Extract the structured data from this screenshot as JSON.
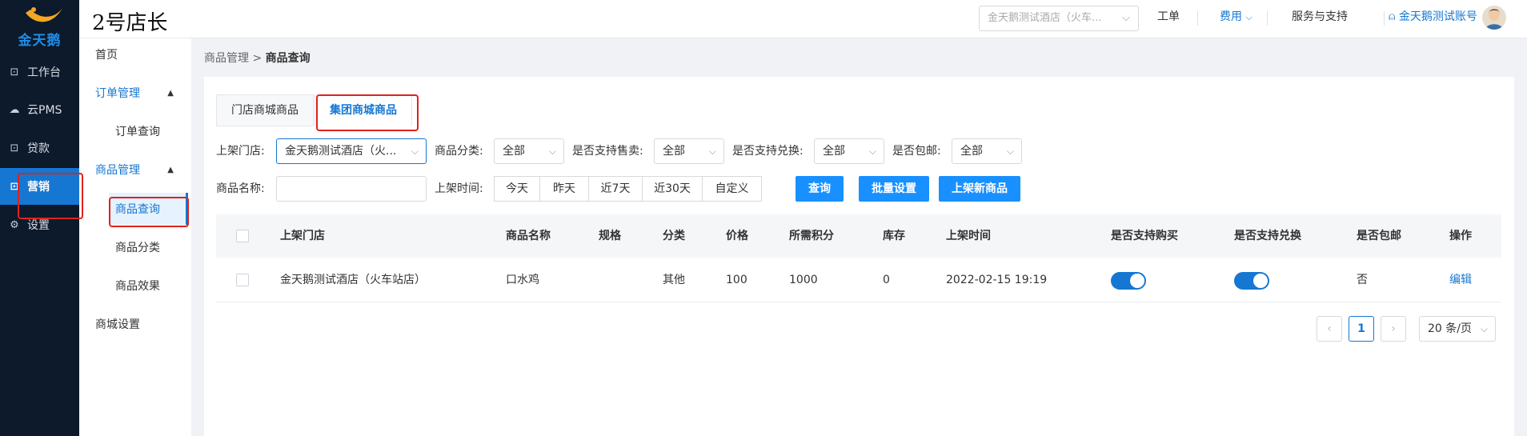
{
  "logo": {
    "text": "金天鹅"
  },
  "nav": [
    {
      "label": "工作台",
      "icon": "dashboard-icon"
    },
    {
      "label": "云PMS",
      "icon": "cloud-icon"
    },
    {
      "label": "贷款",
      "icon": "loan-icon"
    },
    {
      "label": "营销",
      "icon": "marketing-icon"
    },
    {
      "label": "设置",
      "icon": "gear-icon"
    }
  ],
  "header": {
    "brand": "2号店长",
    "store_select": "金天鹅测试酒店（火车...",
    "links": {
      "ticket": "工单",
      "fee": "费用",
      "support": "服务与支持",
      "account": "金天鹅测试账号"
    }
  },
  "submenu": {
    "home": "首页",
    "order_group": "订单管理",
    "order_query": "订单查询",
    "goods_group": "商品管理",
    "goods_query": "商品查询",
    "goods_category": "商品分类",
    "goods_effect": "商品效果",
    "mall_settings": "商城设置"
  },
  "breadcrumb": {
    "parent": "商品管理",
    "separator": ">",
    "current": "商品查询"
  },
  "tabs": [
    {
      "label": "门店商城商品"
    },
    {
      "label": "集团商城商品"
    }
  ],
  "filters": {
    "store_label": "上架门店:",
    "store_value": "金天鹅测试酒店（火...",
    "category_label": "商品分类:",
    "category_value": "全部",
    "sale_label": "是否支持售卖:",
    "sale_value": "全部",
    "exchange_label": "是否支持兑换:",
    "exchange_value": "全部",
    "shipping_label": "是否包邮:",
    "shipping_value": "全部",
    "name_label": "商品名称:",
    "name_value": "",
    "time_label": "上架时间:",
    "time_options": [
      "今天",
      "昨天",
      "近7天",
      "近30天",
      "自定义"
    ],
    "query_btn": "查询",
    "batch_btn": "批量设置",
    "new_btn": "上架新商品"
  },
  "table": {
    "columns": [
      "上架门店",
      "商品名称",
      "规格",
      "分类",
      "价格",
      "所需积分",
      "库存",
      "上架时间",
      "是否支持购买",
      "是否支持兑换",
      "是否包邮",
      "操作"
    ],
    "rows": [
      {
        "store": "金天鹅测试酒店（火车站店）",
        "name": "口水鸡",
        "spec": "",
        "category": "其他",
        "price": "100",
        "points": "1000",
        "stock": "0",
        "time": "2022-02-15 19:19",
        "buy_enabled": true,
        "exchange_enabled": true,
        "shipping": "否",
        "action": "编辑"
      }
    ]
  },
  "pagination": {
    "current": "1",
    "page_size": "20 条/页"
  },
  "colors": {
    "primary": "#1677d2",
    "button": "#1890ff",
    "nav_bg": "#0c1a2b",
    "annotation": "#e0211c"
  }
}
